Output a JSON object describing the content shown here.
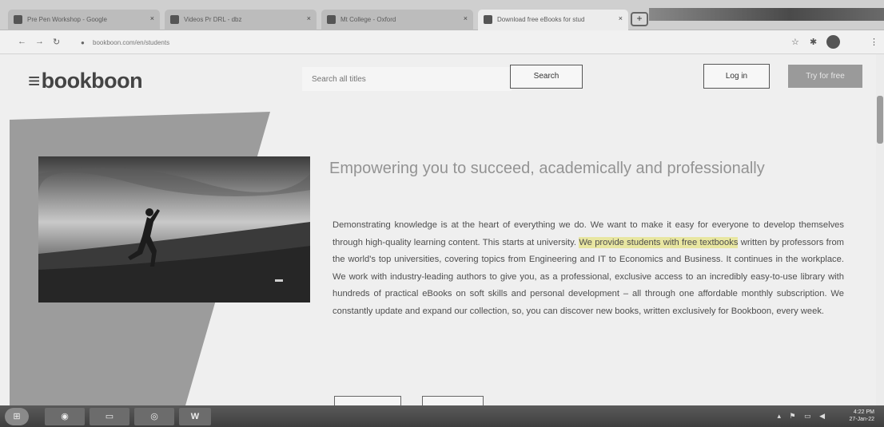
{
  "browser": {
    "tabs": [
      {
        "label": "Pre Pen Workshop - Google",
        "close": "×"
      },
      {
        "label": "Videos Pr DRL - dbz",
        "close": "×"
      },
      {
        "label": "Mt College - Oxford",
        "close": "×"
      },
      {
        "label": "Download free eBooks for stud",
        "close": "×"
      }
    ],
    "new_tab_label": "+",
    "url": "bookboon.com/en/students",
    "nav": {
      "back": "←",
      "forward": "→",
      "reload": "↻"
    },
    "toolbar_icons": {
      "star": "☆",
      "extensions": "✱",
      "menu": "⋮"
    }
  },
  "site": {
    "logo_text": "bookboon",
    "logo_icon": "hamburger-icon",
    "search_placeholder": "Search all titles",
    "search_button": "Search",
    "login_button": "Log in",
    "trial_button": "Try for free"
  },
  "hero": {
    "headline": "Empowering you to succeed, academically and professionally",
    "body_before": "Demonstrating knowledge is at the heart of everything we do. We want to make it easy for everyone to develop themselves through high-quality learning content. This starts at university. ",
    "body_highlight": "We provide students with free textbooks",
    "body_after": " written by professors from the world's top universities, covering topics from Engineering and IT to Economics and Business. It continues in the workplace. We work with industry-leading authors to give you, as a professional, exclusive access to an incredibly easy-to-use library with hundreds of practical eBooks on soft skills and personal development – all through one affordable monthly subscription. We constantly update and expand our collection, so, you can discover new books, written exclusively for Bookboon, every week."
  },
  "taskbar": {
    "items": [
      {
        "icon": "windows-start-icon"
      },
      {
        "icon": "chrome-icon"
      },
      {
        "icon": "file-explorer-icon"
      },
      {
        "icon": "media-player-icon"
      },
      {
        "icon": "word-icon",
        "label": "W"
      }
    ],
    "tray_icons": "▴ ⚑ ▭ ◀",
    "clock_time": "4:22 PM",
    "clock_date": "27-Jan-22"
  },
  "colors": {
    "page_bg": "#efefef",
    "highlight": "#e8e6a1",
    "trial_button_bg": "#9a9a9a"
  }
}
